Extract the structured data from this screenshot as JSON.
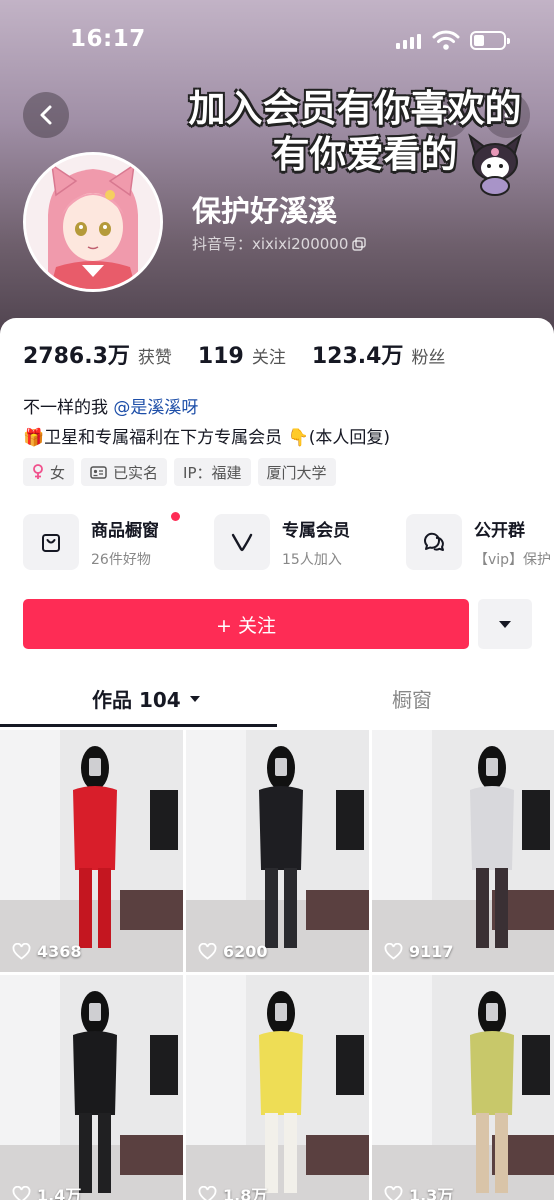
{
  "status": {
    "time": "16:17"
  },
  "header": {
    "promo_line1": "加入会员有你喜欢的",
    "promo_line2": "有你爱看的",
    "nickname": "保护好溪溪",
    "douyin_id": "抖音号：xixixi200000"
  },
  "stats": [
    {
      "value": "2786.3万",
      "label": "获赞"
    },
    {
      "value": "119",
      "label": "关注"
    },
    {
      "value": "123.4万",
      "label": "粉丝"
    }
  ],
  "bio": {
    "line1_text": "不一样的我 ",
    "line1_mention": "@是溪溪呀",
    "line2": "🎁卫星和专属福利在下方专属会员 👇(本人回复)"
  },
  "tags": [
    {
      "icon": "female-icon",
      "label": "女"
    },
    {
      "icon": "id-card-icon",
      "label": "已实名"
    },
    {
      "icon": "",
      "label": "IP：福建"
    },
    {
      "icon": "",
      "label": "厦门大学"
    }
  ],
  "features": [
    {
      "icon": "shopping-bag-icon",
      "title": "商品橱窗",
      "sub": "26件好物"
    },
    {
      "icon": "vip-v-icon",
      "title": "专属会员",
      "sub": "15人加入"
    },
    {
      "icon": "group-chat-icon",
      "title": "公开群",
      "sub": "【vip】保护"
    }
  ],
  "actions": {
    "follow_label": "+ 关注"
  },
  "tabs": {
    "works_label": "作品 104",
    "shop_label": "橱窗"
  },
  "videos": [
    {
      "likes": "4368",
      "outfit": "#d81e2a",
      "legs": "#c41620"
    },
    {
      "likes": "6200",
      "outfit": "#1e1e22",
      "legs": "#2a2a2e"
    },
    {
      "likes": "9117",
      "outfit": "#d8d8dc",
      "legs": "#3a3034"
    },
    {
      "likes": "1.4万",
      "outfit": "#1a1a1c",
      "legs": "#202022"
    },
    {
      "likes": "1.8万",
      "outfit": "#eedd55",
      "legs": "#f2f0ea"
    },
    {
      "likes": "1.3万",
      "outfit": "#c8c86a",
      "legs": "#d9c4a8"
    }
  ]
}
